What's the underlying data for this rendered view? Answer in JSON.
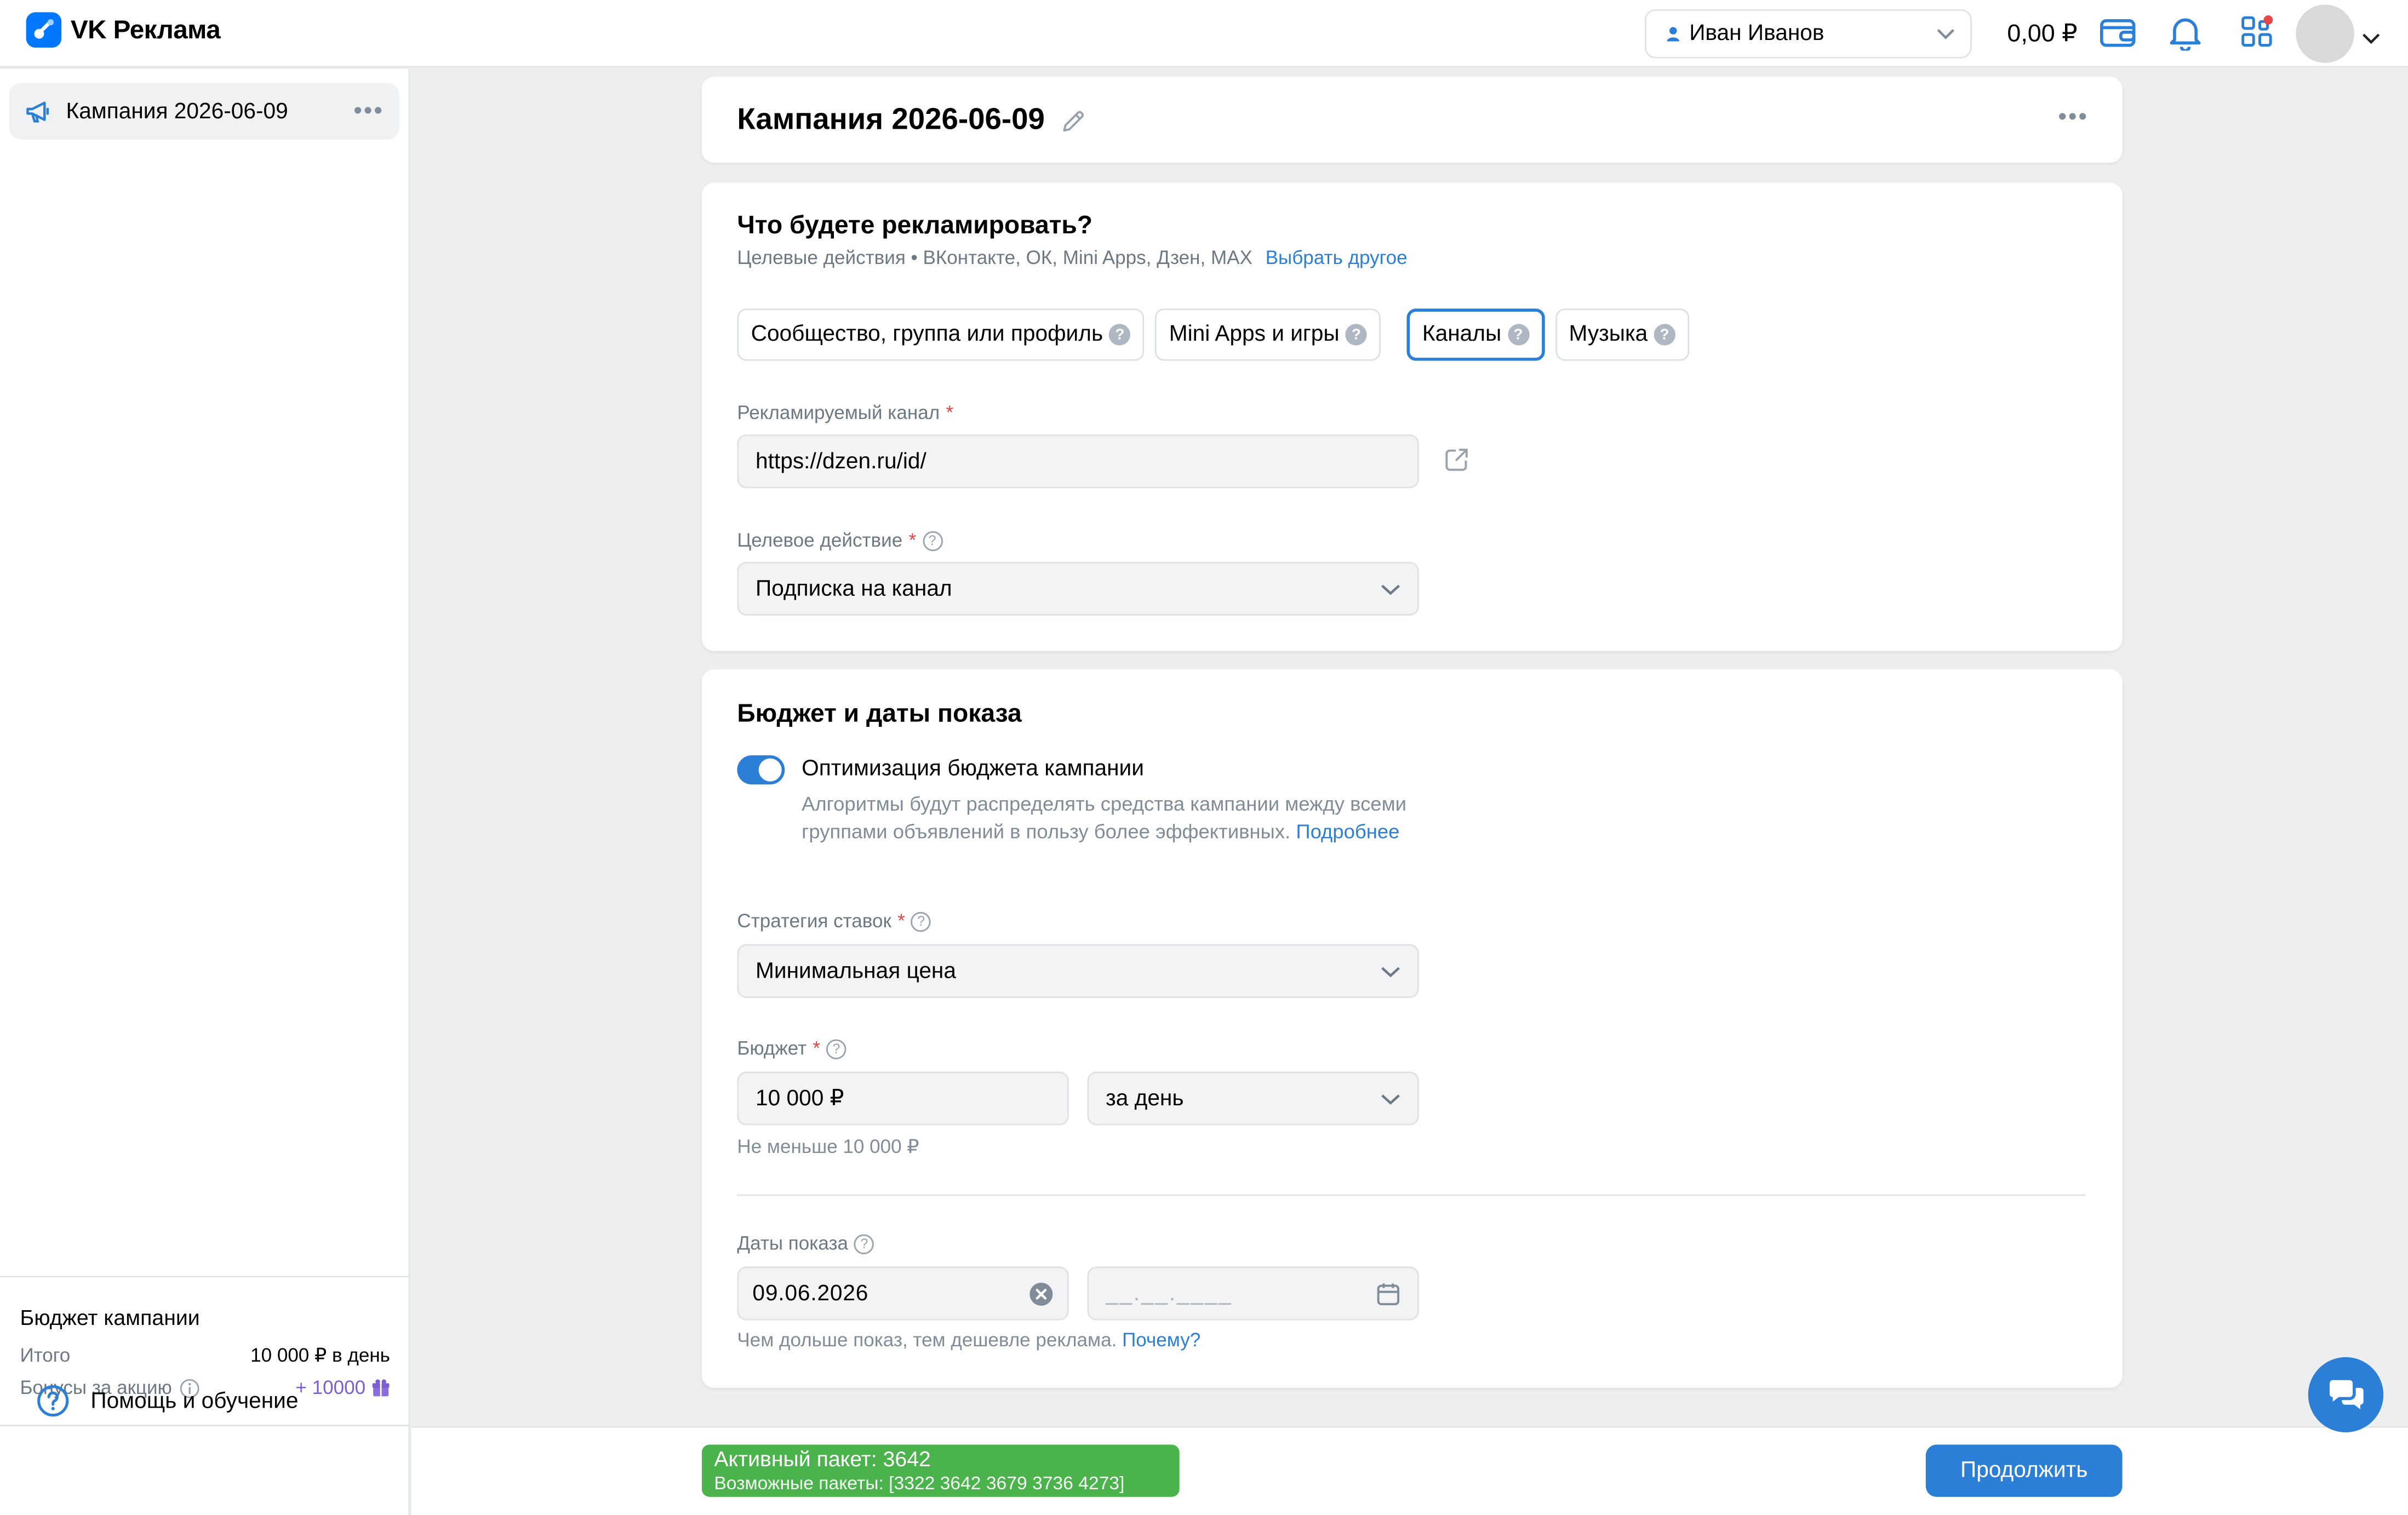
{
  "app": {
    "title": "VK Реклама"
  },
  "header": {
    "account_name": "Иван Иванов",
    "balance": "0,00 ₽"
  },
  "sidebar": {
    "campaign_item": "Кампания 2026-06-09",
    "budget": {
      "title": "Бюджет кампании",
      "total_label": "Итого",
      "total_value": "10 000 ₽ в день",
      "bonus_label": "Бонусы за акцию",
      "bonus_value": "+ 10000"
    },
    "help_label": "Помощь и обучение"
  },
  "campaign": {
    "title": "Кампания 2026-06-09"
  },
  "promote": {
    "title": "Что будете рекламировать?",
    "subtitle": "Целевые действия • ВКонтакте, ОК, Mini Apps, Дзен, MAX",
    "choose_other": "Выбрать другое",
    "chips": [
      {
        "label": "Сообщество, группа или профиль",
        "active": false
      },
      {
        "label": "Mini Apps и игры",
        "active": false
      },
      {
        "label": "Каналы",
        "active": true
      },
      {
        "label": "Музыка",
        "active": false
      }
    ],
    "channel_label": "Рекламируемый канал",
    "channel_value": "https://dzen.ru/id/",
    "action_label": "Целевое действие",
    "action_value": "Подписка на канал"
  },
  "budget": {
    "title": "Бюджет и даты показа",
    "optimization_title": "Оптимизация бюджета кампании",
    "optimization_desc": "Алгоритмы будут распределять средства кампании между всеми группами объявлений в пользу более эффективных.",
    "more_link": "Подробнее",
    "strategy_label": "Стратегия ставок",
    "strategy_value": "Минимальная цена",
    "budget_label": "Бюджет",
    "budget_value": "10 000 ₽",
    "period_value": "за день",
    "budget_hint": "Не меньше 10 000 ₽",
    "dates_label": "Даты показа",
    "date_start": "09.06.2026",
    "date_end_placeholder": "__.__.____",
    "dates_hint": "Чем дольше показ, тем дешевле реклама.",
    "why_link": "Почему?"
  },
  "bottom": {
    "active_package": "Активный пакет: 3642",
    "possible_packages": "Возможные пакеты: [3322 3642 3679 3736 4273]",
    "continue_label": "Продолжить"
  },
  "colors": {
    "accent": "#2b7fd6",
    "success": "#4bb34b",
    "required": "#e64646"
  }
}
